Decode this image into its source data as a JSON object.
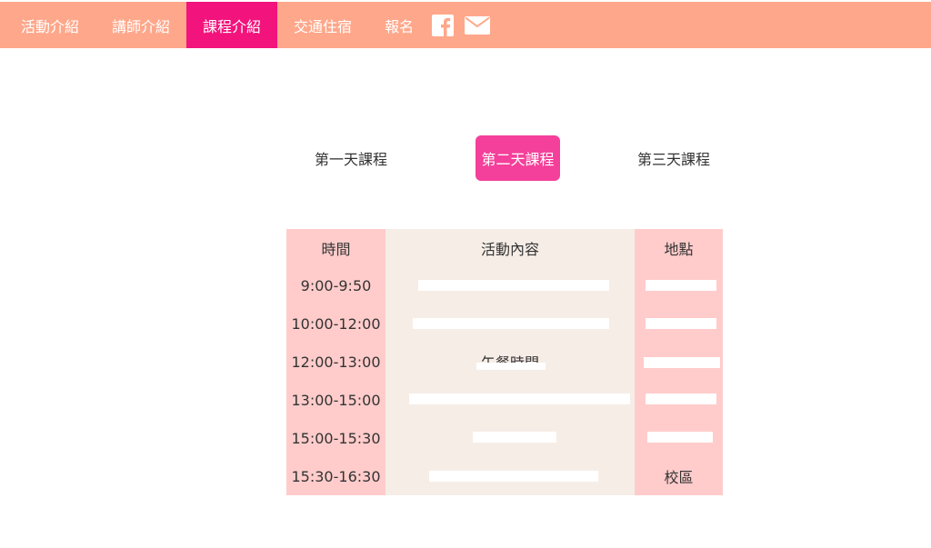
{
  "nav": {
    "items": [
      "活動介紹",
      "講師介紹",
      "課程介紹",
      "交通住宿",
      "報名"
    ],
    "active": "課程介紹",
    "icons": [
      "facebook-icon",
      "mail-icon"
    ]
  },
  "colors": {
    "navbar": "#ffa78a",
    "nav_active": "#f2137c",
    "tab_active": "#f4409a",
    "time_col": "#ffcccb",
    "activity_col": "#f6ede7"
  },
  "tabs": {
    "items": [
      "第一天課程",
      "第二天課程",
      "第三天課程"
    ],
    "active": "第二天課程"
  },
  "schedule": {
    "headers": [
      "時間",
      "活動內容",
      "地點"
    ],
    "rows": [
      {
        "time": "9:00-9:50",
        "activity": "",
        "location": ""
      },
      {
        "time": "10:00-12:00",
        "activity": "",
        "location": ""
      },
      {
        "time": "12:00-13:00",
        "activity": "午餐時間",
        "location": ""
      },
      {
        "time": "13:00-15:00",
        "activity": "",
        "location": ""
      },
      {
        "time": "15:00-15:30",
        "activity": "",
        "location": ""
      },
      {
        "time": "15:30-16:30",
        "activity": "",
        "location": "校區"
      }
    ]
  }
}
